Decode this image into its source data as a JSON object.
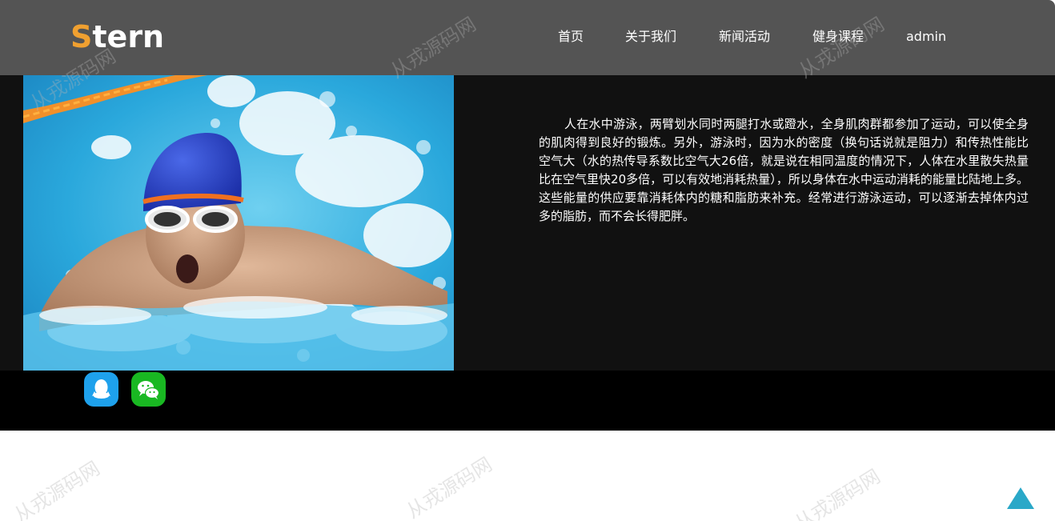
{
  "header": {
    "logo_first": "S",
    "logo_rest": "tern",
    "nav": [
      "首页",
      "关于我们",
      "新闻活动",
      "健身课程",
      "admin"
    ]
  },
  "article": {
    "text": "人在水中游泳，两臂划水同时两腿打水或蹬水，全身肌肉群都参加了运动，可以使全身的肌肉得到良好的锻炼。另外，游泳时，因为水的密度（换句话说就是阻力）和传热性能比空气大（水的热传导系数比空气大26倍，就是说在相同温度的情况下，人体在水里散失热量比在空气里快20多倍，可以有效地消耗热量），所以身体在水中运动消耗的能量比陆地上多。这些能量的供应要靠消耗体内的糖和脂肪来补充。经常进行游泳运动，可以逐渐去掉体内过多的脂肪，而不会长得肥胖。"
  },
  "footer": {
    "social": [
      {
        "name": "qq-icon",
        "color": "#1ea1ec"
      },
      {
        "name": "wechat-icon",
        "color": "#19b822"
      }
    ]
  },
  "watermark": "从戎源码网",
  "colors": {
    "header_bg": "#545454",
    "logo_accent": "#f0a030",
    "content_bg": "#111111",
    "footer_bg": "#000000",
    "back_to_top": "#2aa8c8"
  }
}
